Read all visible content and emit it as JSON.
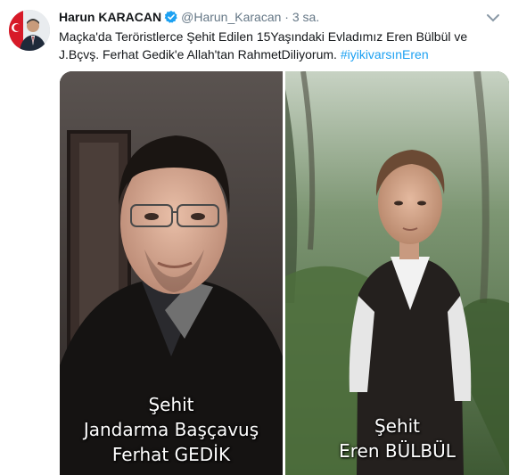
{
  "tweet": {
    "author_name": "Harun KARACAN",
    "handle": "@Harun_Karacan",
    "separator": "·",
    "time": "3 sa.",
    "text_before": "Maçka'da Teröristlerce Şehit Edilen 15Yaşındaki Evladımız Eren Bülbül ve J.Bçvş. Ferhat Gedik'e Allah'tan RahmetDiliyorum. ",
    "hashtag": "#iyikivarsınEren"
  },
  "media": {
    "left_caption": [
      "Şehit",
      "Jandarma Başçavuş",
      "Ferhat GEDİK"
    ],
    "right_caption": [
      "Şehit",
      "Eren BÜLBÜL"
    ]
  },
  "icons": {
    "verified": "verified-badge-icon",
    "caret": "chevron-down-icon"
  },
  "colors": {
    "link": "#1da1f2",
    "secondary_text": "#657786"
  }
}
